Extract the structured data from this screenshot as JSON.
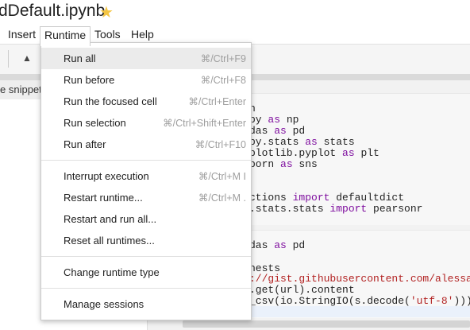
{
  "title": "dDefault.ipynb",
  "menubar": [
    "Insert",
    "Runtime",
    "Tools",
    "Help"
  ],
  "sidebar": {
    "snippets_label": "e snippets"
  },
  "runtime_menu": {
    "groups": [
      [
        {
          "label": "Run all",
          "shortcut": "⌘/Ctrl+F9"
        },
        {
          "label": "Run before",
          "shortcut": "⌘/Ctrl+F8"
        },
        {
          "label": "Run the focused cell",
          "shortcut": "⌘/Ctrl+Enter"
        },
        {
          "label": "Run selection",
          "shortcut": "⌘/Ctrl+Shift+Enter"
        },
        {
          "label": "Run after",
          "shortcut": "⌘/Ctrl+F10"
        }
      ],
      [
        {
          "label": "Interrupt execution",
          "shortcut": "⌘/Ctrl+M I"
        },
        {
          "label": "Restart runtime...",
          "shortcut": "⌘/Ctrl+M ."
        },
        {
          "label": "Restart and run all...",
          "shortcut": ""
        },
        {
          "label": "Reset all runtimes...",
          "shortcut": ""
        }
      ],
      [
        {
          "label": "Change runtime type",
          "shortcut": ""
        }
      ],
      [
        {
          "label": "Manage sessions",
          "shortcut": ""
        }
      ]
    ]
  },
  "cell1": [
    [
      "n",
      "",
      ""
    ],
    [
      "py ",
      "as",
      " np"
    ],
    [
      "das ",
      "as",
      " pd"
    ],
    [
      "py.stats ",
      "as",
      " stats"
    ],
    [
      "plotlib.pyplot ",
      "as",
      " plt"
    ],
    [
      "born ",
      "as",
      " sns"
    ],
    [
      "",
      "",
      ""
    ],
    [
      "",
      "",
      ""
    ],
    [
      "ctions ",
      "import",
      " defaultdict"
    ],
    [
      ".stats.stats ",
      "import",
      " pearsonr"
    ]
  ],
  "cell2": {
    "line1": [
      "das ",
      "as",
      " pd"
    ],
    "line2": "nests",
    "line3": "://gist.githubusercontent.com/alessa",
    "line4": ".get(url).content",
    "line5a": "_csv(io.StringIO(s.decode(",
    "line5s": "'utf-8'",
    "line5b": ")))"
  },
  "colors": {
    "keyword": "#7f0f9f",
    "string": "#b22222",
    "star": "#f4c542"
  }
}
